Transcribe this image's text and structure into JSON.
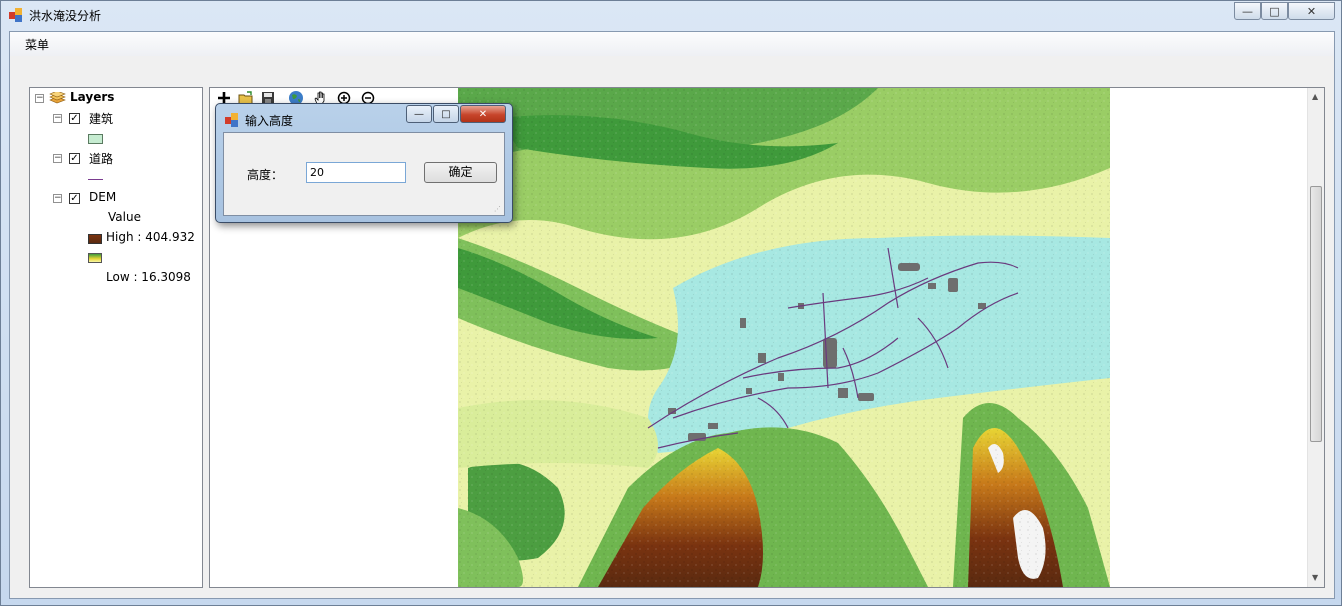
{
  "window": {
    "title": "洪水淹没分析",
    "controls": {
      "minimize": "—",
      "maximize": "□",
      "close": "✕"
    }
  },
  "menu": {
    "items": [
      {
        "label": "菜单"
      }
    ]
  },
  "toc": {
    "root_label": "Layers",
    "layers": [
      {
        "label": "建筑",
        "checked": true,
        "symbol_color": "#c6ecd1"
      },
      {
        "label": "道路",
        "checked": true,
        "symbol_color": "#7a3b8f"
      },
      {
        "label": "DEM",
        "checked": true,
        "value_heading": "Value",
        "high_label": "High : 404.932",
        "low_label": "Low : 16.3098"
      }
    ]
  },
  "toolbar": {
    "tools": [
      "add-data-icon",
      "open-icon",
      "save-icon",
      "globe-icon",
      "pan-hand-icon",
      "zoom-in-icon",
      "zoom-out-icon"
    ]
  },
  "dialog": {
    "title": "输入高度",
    "field_label": "高度：",
    "field_value": "20",
    "ok_label": "确定"
  },
  "colors": {
    "flood": "#a7e8e2",
    "roads": "#6a3a7e",
    "buildings": "#6e6e6e",
    "dem_low": "#f7f7a8",
    "dem_mid": "#3f9a3b",
    "dem_high": "#7a3310"
  }
}
